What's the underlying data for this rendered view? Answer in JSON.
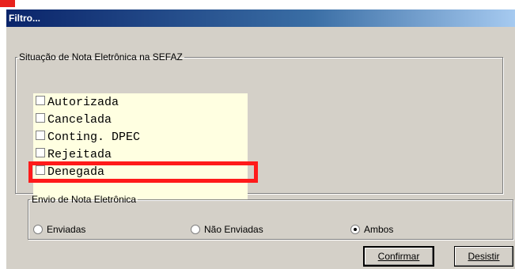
{
  "window": {
    "title": "Filtro..."
  },
  "situacao_group": {
    "legend": "Situação de Nota Eletrônica na SEFAZ",
    "items": [
      {
        "label": "Autorizada",
        "checked": false
      },
      {
        "label": "Cancelada",
        "checked": false
      },
      {
        "label": "Conting. DPEC",
        "checked": false
      },
      {
        "label": "Rejeitada",
        "checked": false
      },
      {
        "label": "Denegada",
        "checked": false
      }
    ]
  },
  "envio_group": {
    "legend": "Envio de Nota Eletrônica",
    "options": [
      {
        "label": "Enviadas",
        "selected": false
      },
      {
        "label": "Não Enviadas",
        "selected": false
      },
      {
        "label": "Ambos",
        "selected": true
      }
    ]
  },
  "buttons": {
    "confirm": "Confirmar",
    "cancel": "Desistir"
  },
  "colors": {
    "highlight": "#ff1a1a",
    "titlebar": "#0a246a",
    "listbox_bg": "#ffffe1"
  }
}
